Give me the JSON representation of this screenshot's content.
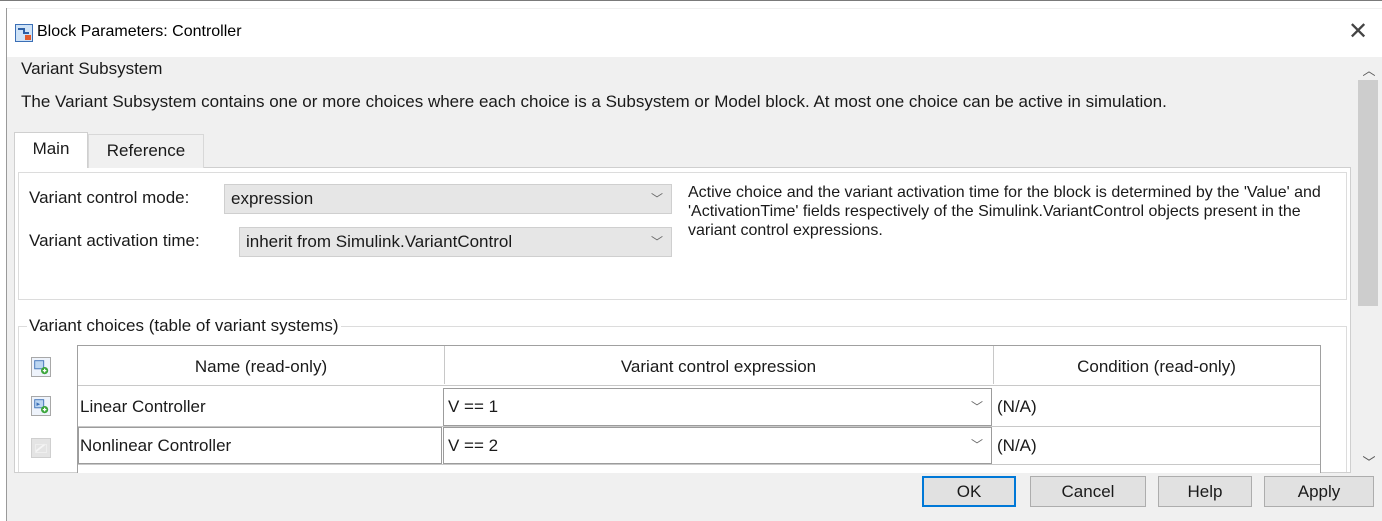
{
  "window": {
    "title": "Block Parameters: Controller",
    "close_glyph": "✕"
  },
  "header": {
    "title": "Variant Subsystem",
    "description": "The Variant Subsystem contains one or more choices where each choice is a Subsystem or Model block. At most one choice can be active in simulation."
  },
  "tabs": [
    {
      "label": "Main",
      "selected": true
    },
    {
      "label": "Reference",
      "selected": false
    }
  ],
  "main": {
    "control_mode_label": "Variant control mode:",
    "control_mode_value": "expression",
    "activation_time_label": "Variant activation time:",
    "activation_time_value": "inherit from Simulink.VariantControl",
    "info_text": "Active choice and the variant activation time for the block is determined by the 'Value' and 'ActivationTime' fields respectively of the Simulink.VariantControl objects present in the variant control expressions."
  },
  "choices": {
    "legend": "Variant choices (table of variant systems)",
    "columns": [
      "Name (read-only)",
      "Variant control expression",
      "Condition (read-only)"
    ],
    "rows": [
      {
        "name": "Linear Controller",
        "expression": "V == 1",
        "condition": "(N/A)"
      },
      {
        "name": "Nonlinear Controller",
        "expression": "V == 2",
        "condition": "(N/A)"
      }
    ]
  },
  "buttons": {
    "ok": "OK",
    "cancel": "Cancel",
    "help": "Help",
    "apply": "Apply"
  },
  "icons": {
    "chevron": "chevron-down-icon",
    "scroll_up": "scroll-up-icon",
    "scroll_down": "scroll-down-icon"
  },
  "colors": {
    "accent": "#0078d7",
    "dialog_bg": "#f0f0f0",
    "combo_bg": "#e6e6e6"
  }
}
